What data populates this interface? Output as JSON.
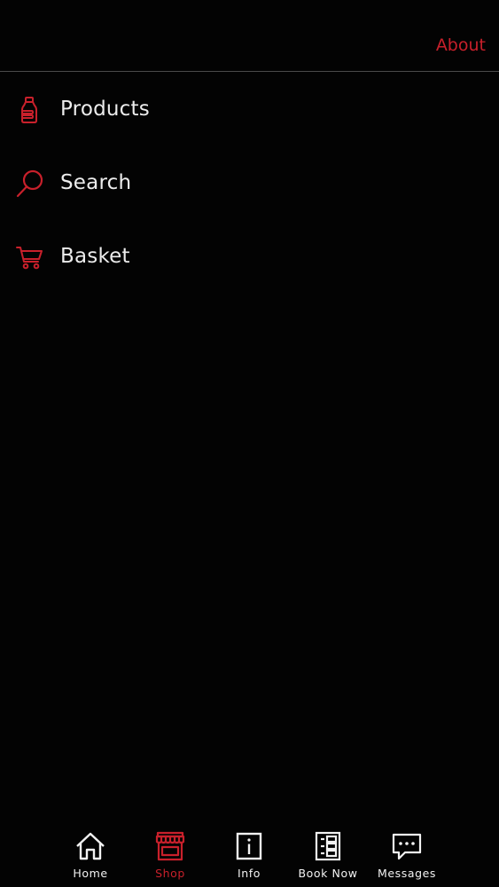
{
  "header": {
    "about_label": "About"
  },
  "menu": {
    "items": [
      {
        "label": "Products",
        "icon": "bottle-icon"
      },
      {
        "label": "Search",
        "icon": "search-icon"
      },
      {
        "label": "Basket",
        "icon": "cart-icon"
      }
    ]
  },
  "tabbar": {
    "active": "Shop",
    "tabs": [
      {
        "label": "Home",
        "icon": "home-icon"
      },
      {
        "label": "Shop",
        "icon": "store-icon"
      },
      {
        "label": "Info",
        "icon": "info-icon"
      },
      {
        "label": "Book Now",
        "icon": "booking-icon"
      },
      {
        "label": "Messages",
        "icon": "chat-icon"
      }
    ]
  },
  "colors": {
    "background": "#030303",
    "accent": "#c8202b",
    "text": "#ececec",
    "divider": "#4a4a4a"
  }
}
